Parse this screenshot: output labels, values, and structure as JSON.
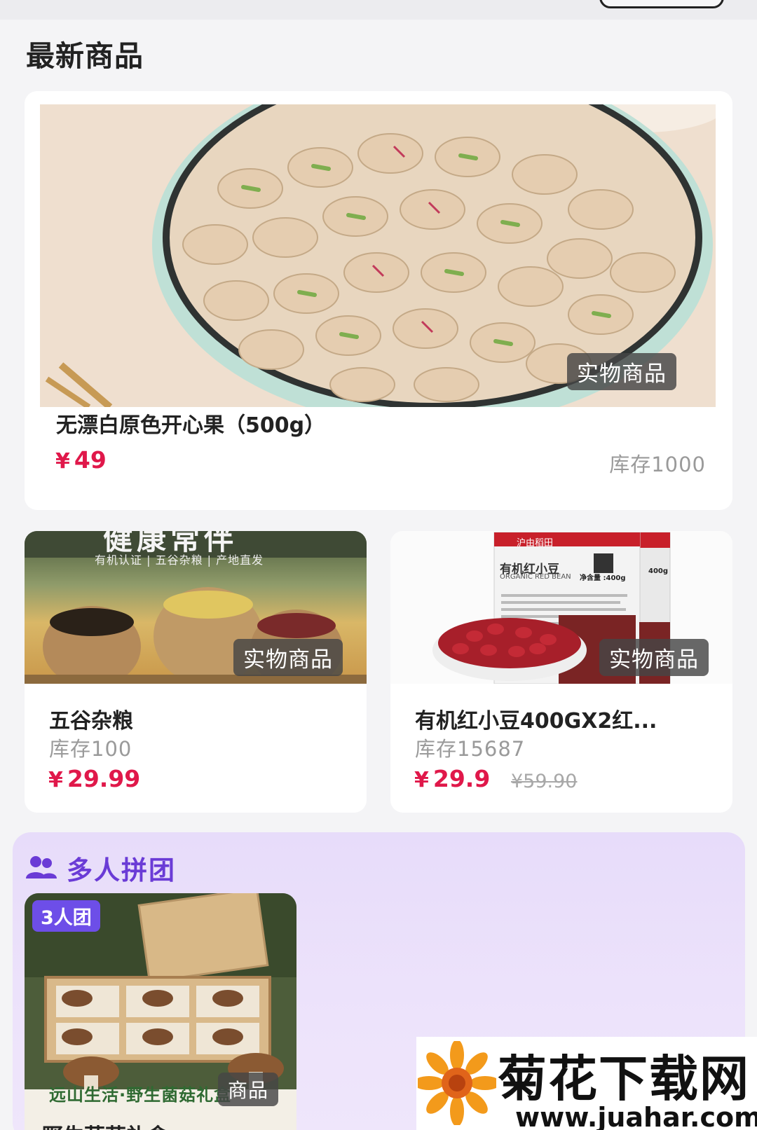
{
  "section_title": "最新商品",
  "tag_label": "实物商品",
  "products": [
    {
      "name": "无漂白原色开心果（500g）",
      "currency": "¥",
      "price": "49",
      "stock": "库存1000"
    },
    {
      "name": "五谷杂粮",
      "currency": "¥",
      "price": "29.99",
      "stock": "库存100",
      "banner_line": "有机认证 | 五谷杂粮 | 产地直发",
      "banner_big": "健康常伴"
    },
    {
      "name": "有机红小豆400GX2红...",
      "currency": "¥",
      "price": "29.9",
      "old_price": "¥59.90",
      "stock": "库存15687",
      "package_brand": "沪由稻田",
      "package_title": "有机红小豆",
      "package_en": "ORGANIC RED BEAN",
      "package_net": "净含量 :400g",
      "package_net2": "400g"
    }
  ],
  "group": {
    "title": "多人拼团",
    "badge": "3人团",
    "image_caption": "远山生活·野生菌菇礼盒",
    "tag_label": "商品",
    "name_partial": "野生菌菇礼盒"
  },
  "watermark": {
    "title": "菊花下载网",
    "url": "www.juahar.com"
  },
  "colors": {
    "price": "#e0184a",
    "accent": "#6a3bd6",
    "badge": "#6d4ee8"
  }
}
